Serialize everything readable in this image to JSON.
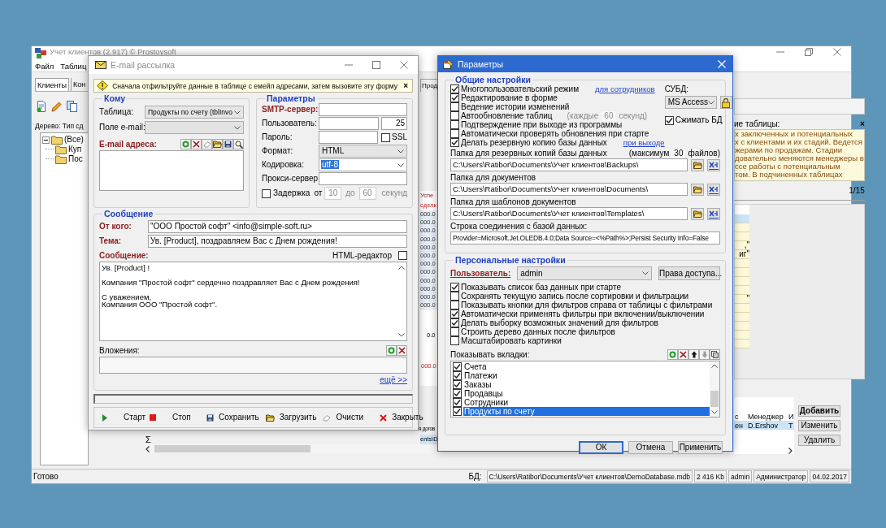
{
  "main_window": {
    "title": "Учет клиентов (2.917) © Prostoysoft",
    "menu": [
      "Файл",
      "Таблиц"
    ],
    "tabs": [
      {
        "label": "Клиенты",
        "selected": true
      },
      {
        "label": "Кон",
        "selected": false
      }
    ],
    "tab_right": "Прод",
    "tree_caption": "Дерево: Тип сд",
    "tree": [
      {
        "label": "(Все)",
        "expanded": true,
        "children": [
          {
            "label": "Куп"
          },
          {
            "label": "Пос"
          }
        ]
      }
    ],
    "grid_strip": {
      "header": [
        "Успе",
        "сделк"
      ],
      "rows": [
        "000.0",
        "000.0",
        "000.0",
        "000.0",
        "000.0",
        "000.0",
        "000.0",
        "000.0",
        "000.0",
        "000.0",
        "000.0",
        "000.0"
      ],
      "total": "0.0",
      "footer": "000.0"
    },
    "description": {
      "caption": "ие таблицы:",
      "close": "×",
      "lines": [
        "х заключенных и потенциальных",
        "х с клиентами и их стадий. Ведется",
        "жерами по продажам. Стадии",
        "довательно меняются менеджеры в",
        "ссе работы с потенциальным",
        "том. В подчиненных таблицах"
      ]
    },
    "counter": "1/15",
    "grid_cells": [
      {
        "selected": true
      },
      {
        "selected": false
      },
      {
        "selected": false
      },
      {
        "selected": false,
        "text": ",\""
      },
      {
        "selected": false,
        "text": "иг\""
      },
      {
        "selected": false
      },
      {
        "selected": false
      },
      {
        "selected": false
      },
      {
        "selected": false
      },
      {
        "selected": false,
        "text": "\""
      },
      {
        "selected": false
      },
      {
        "selected": false
      },
      {
        "selected": false
      },
      {
        "selected": false
      },
      {
        "selected": false
      }
    ],
    "sigma": "Σ",
    "subtable": {
      "left_header": "я догов",
      "left_row": "ents\\D",
      "columns": [
        "с",
        "Менеджер",
        "И"
      ],
      "row": [
        "ен",
        "D.Ershov",
        "Т"
      ]
    },
    "actions": [
      {
        "label": "Добавить",
        "default": true
      },
      {
        "label": "Изменить",
        "default": false
      },
      {
        "label": "Удалить",
        "default": false
      }
    ],
    "status_bar": {
      "message": "Готово",
      "db_label": "БД:",
      "db_path": "C:\\Users\\Ratibor\\Documents\\Учет клиентов\\DemoDatabase.mdb",
      "size": "2 416 Kb",
      "user": "admin",
      "role": "Администратор",
      "date": "04.02.2017"
    }
  },
  "email_dialog": {
    "title": "E-mail рассылка",
    "notice": "Сначала отфильтруйте данные в таблице с емейл адресами, затем вызовите эту форму",
    "notice_close": "×",
    "to": {
      "legend": "Кому",
      "table_label": "Таблица:",
      "table_value": "Продукты по счету (tblInvo",
      "field_label": "Поле e-mail:",
      "addresses_label": "E-mail адреса:"
    },
    "params": {
      "legend": "Параметры",
      "smtp_label": "SMTP-сервер:",
      "user_label": "Пользователь:",
      "port": "25",
      "password_label": "Пароль:",
      "ssl": {
        "label": "SSL",
        "checked": false
      },
      "format_label": "Формат:",
      "format_value": "HTML",
      "encoding_label": "Кодировка:",
      "encoding_value": "utf-8",
      "proxy_label": "Прокси-сервер:",
      "delay": {
        "label": "Задержка",
        "checked": false,
        "from_label": "от",
        "from": "10",
        "to_label": "до",
        "to": "60",
        "unit": "секунд"
      }
    },
    "message": {
      "legend": "Сообщение",
      "from_label": "От кого:",
      "from": "\"ООО Простой софт\" <info@simple-soft.ru>",
      "subject_label": "Тема:",
      "subject": "Ув. [Product], поздравляем Вас с Днем рождения!",
      "body_label": "Сообщение:",
      "html_editor": {
        "label": "HTML-редактор",
        "checked": false
      },
      "body": "Ув. [Product] !\n\nКомпания \"Простой софт\" сердечно поздравляет Вас с Днем рождения!\n\nС уважением,\nКомпания ООО \"Простой софт\".",
      "attachments_label": "Вложения:",
      "more_link": "ещё >>"
    },
    "buttons": [
      "Старт",
      "Стоп",
      "Сохранить",
      "Загрузить",
      "Очисти",
      "Закрыть"
    ]
  },
  "settings_dialog": {
    "title": "Параметры",
    "general": {
      "legend": "Общие настройки",
      "options": [
        {
          "label": "Многопользовательский режим",
          "checked": true,
          "link": "для сотрудников"
        },
        {
          "label": "Редактирование в форме",
          "checked": true
        },
        {
          "label": "Ведение истории изменений",
          "checked": false
        },
        {
          "label": "Автообновление таблиц",
          "checked": false,
          "interval": {
            "prefix": "(каждые",
            "value": "60",
            "suffix": "секунд)"
          }
        },
        {
          "label": "Подтверждение при выходе из программы",
          "checked": false
        },
        {
          "label": "Автоматически проверять обновления при старте",
          "checked": false
        },
        {
          "label": "Делать резервную копию базы данных",
          "checked": true,
          "link": "при выходе"
        }
      ],
      "dbms_label": "СУБД:",
      "dbms_value": "MS Access",
      "compress": {
        "label": "Сжимать БД",
        "checked": true
      },
      "folders": [
        {
          "label": "Папка для резервных копий базы данных",
          "limit": {
            "prefix": "(максимум",
            "value": "30",
            "suffix": "файлов)"
          },
          "path": "C:\\Users\\Ratibor\\Documents\\Учет клиентов\\Backups\\"
        },
        {
          "label": "Папка для документов",
          "path": "C:\\Users\\Ratibor\\Documents\\Учет клиентов\\Documents\\"
        },
        {
          "label": "Папка для шаблонов документов",
          "path": "C:\\Users\\Ratibor\\Documents\\Учет клиентов\\Templates\\"
        }
      ],
      "connection_label": "Строка соединения с базой данных:",
      "connection": "Provider=Microsoft.Jet.OLEDB.4.0;Data Source=<%Path%>;Persist Security Info=False"
    },
    "personal": {
      "legend": "Персональные настройки",
      "user_label": "Пользователь:",
      "user": "admin",
      "rights_button": "Права доступа...",
      "options": [
        {
          "label": "Показывать список баз данных при старте",
          "checked": true
        },
        {
          "label": "Сохранять текущую запись после сортировки и фильтрации",
          "checked": false
        },
        {
          "label": "Показывать кнопки для фильтров справа от таблицы с фильтрами",
          "checked": false
        },
        {
          "label": "Автоматически применять фильтры при включении/выключении",
          "checked": true
        },
        {
          "label": "Делать выборку возможных значений для фильтров",
          "checked": true
        },
        {
          "label": "Строить дерево данных после фильтров",
          "checked": false
        },
        {
          "label": "Масштабировать картинки",
          "checked": false
        }
      ],
      "tabs_label": "Показывать вкладки:",
      "tabs": [
        {
          "label": "Счета",
          "checked": true,
          "selected": false
        },
        {
          "label": "Платежи",
          "checked": true,
          "selected": false
        },
        {
          "label": "Заказы",
          "checked": true,
          "selected": false
        },
        {
          "label": "Продавцы",
          "checked": true,
          "selected": false
        },
        {
          "label": "Сотрудники",
          "checked": true,
          "selected": false
        },
        {
          "label": "Продукты по счету",
          "checked": true,
          "selected": true
        }
      ]
    },
    "buttons": [
      {
        "label": "ОК",
        "default": true
      },
      {
        "label": "Отмена",
        "default": false
      },
      {
        "label": "Применить",
        "default": false
      }
    ]
  }
}
